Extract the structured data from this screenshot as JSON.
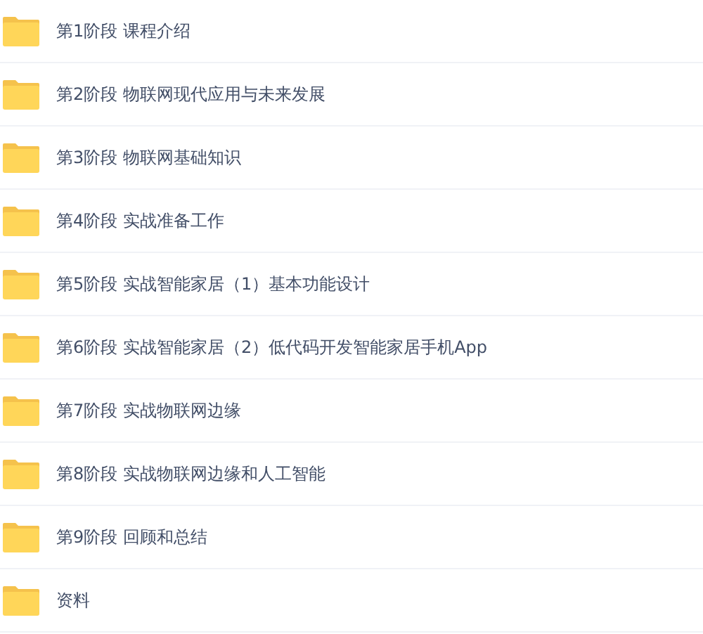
{
  "items": [
    {
      "name": "第1阶段 课程介绍"
    },
    {
      "name": "第2阶段 物联网现代应用与未来发展"
    },
    {
      "name": "第3阶段 物联网基础知识"
    },
    {
      "name": "第4阶段 实战准备工作"
    },
    {
      "name": "第5阶段 实战智能家居（1）基本功能设计"
    },
    {
      "name": "第6阶段 实战智能家居（2）低代码开发智能家居手机App"
    },
    {
      "name": "第7阶段 实战物联网边缘"
    },
    {
      "name": "第8阶段 实战物联网边缘和人工智能"
    },
    {
      "name": "第9阶段 回顾和总结"
    },
    {
      "name": "资料"
    }
  ]
}
